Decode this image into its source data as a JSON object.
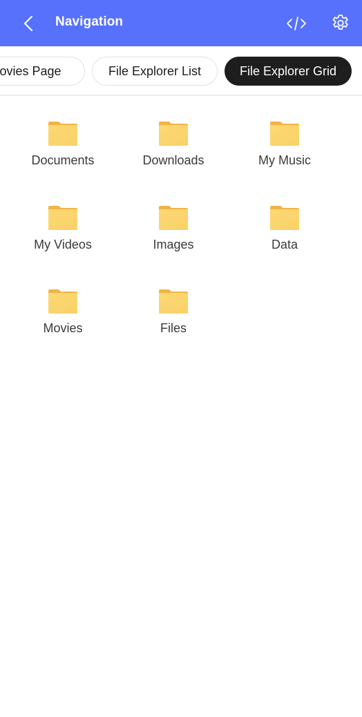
{
  "appbar": {
    "title": "Navigation",
    "back_icon": "chevron-left-icon",
    "code_icon": "code-icon",
    "settings_icon": "gear-icon",
    "background_color": "#5771fd"
  },
  "tabs": [
    {
      "label": "Movies Page",
      "selected": false
    },
    {
      "label": "File Explorer List",
      "selected": false
    },
    {
      "label": "File Explorer Grid",
      "selected": true
    }
  ],
  "folders": [
    {
      "name": "Documents",
      "icon": "folder-icon"
    },
    {
      "name": "Downloads",
      "icon": "folder-icon"
    },
    {
      "name": "My Music",
      "icon": "folder-icon"
    },
    {
      "name": "My Videos",
      "icon": "folder-icon"
    },
    {
      "name": "Images",
      "icon": "folder-icon"
    },
    {
      "name": "Data",
      "icon": "folder-icon"
    },
    {
      "name": "Movies",
      "icon": "folder-icon"
    },
    {
      "name": "Files",
      "icon": "folder-icon"
    }
  ],
  "colors": {
    "folder_body": "#fbd76e",
    "folder_tab": "#f2b445",
    "selected_tab_bg": "#1e1e1e"
  }
}
